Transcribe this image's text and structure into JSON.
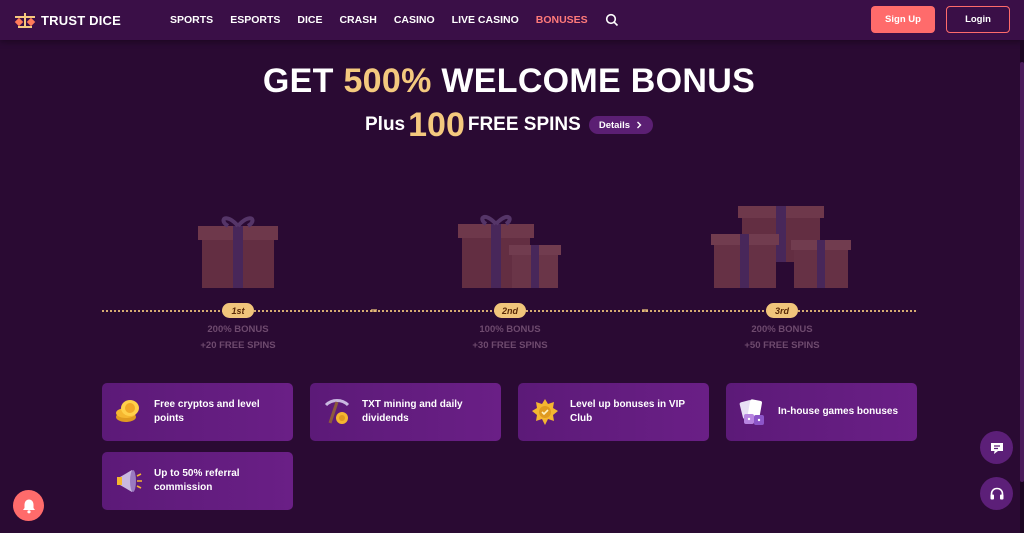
{
  "nav": {
    "brand": "TRUST DICE",
    "items": [
      {
        "label": "SPORTS"
      },
      {
        "label": "ESPORTS"
      },
      {
        "label": "DICE"
      },
      {
        "label": "CRASH"
      },
      {
        "label": "CASINO"
      },
      {
        "label": "LIVE CASINO"
      },
      {
        "label": "BONUSES",
        "active": true
      }
    ],
    "search_icon": "search-icon",
    "signup": "Sign Up",
    "login": "Login"
  },
  "hero": {
    "title_pre": "GET ",
    "title_highlight": "500%",
    "title_post": " WELCOME BONUS",
    "plus": "Plus",
    "spins_number": "100",
    "spins_text": "FREE SPINS",
    "details": "Details",
    "details_icon": "chevron-right-icon"
  },
  "steps": [
    {
      "rank": "1st",
      "bonus": "200% BONUS",
      "spins": "+20 FREE SPINS"
    },
    {
      "rank": "2nd",
      "bonus": "100% BONUS",
      "spins": "+30 FREE SPINS"
    },
    {
      "rank": "3rd",
      "bonus": "200% BONUS",
      "spins": "+50 FREE SPINS"
    }
  ],
  "features": [
    {
      "label": "Free cryptos and level points",
      "icon": "coins-icon"
    },
    {
      "label": "TXT mining and daily dividends",
      "icon": "pickaxe-icon"
    },
    {
      "label": "Level up bonuses in VIP Club",
      "icon": "vip-badge-icon"
    },
    {
      "label": "In-house games bonuses",
      "icon": "cards-dice-icon"
    },
    {
      "label": "Up to 50% referral commission",
      "icon": "megaphone-icon"
    }
  ],
  "floating": {
    "bell_icon": "bell-icon",
    "chat_icon": "chat-icon",
    "support_icon": "headset-icon"
  },
  "colors": {
    "background": "#2a0a33",
    "nav": "#3a0f47",
    "accent": "#ff6b6b",
    "gold": "#f4c97e",
    "card": "#5c1a78"
  }
}
